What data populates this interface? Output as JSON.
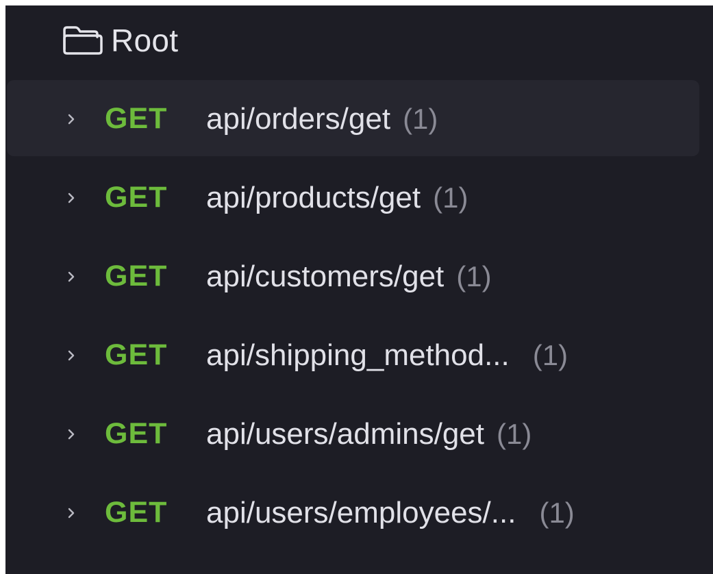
{
  "root": {
    "label": "Root",
    "icon": "folder-icon"
  },
  "colors": {
    "panel_bg": "#1d1d25",
    "selected_row_bg": "#26262f",
    "method_get": "#6dbb3c",
    "path_text": "#e1e1e8",
    "count_text": "#8a8a95"
  },
  "endpoints": [
    {
      "method": "GET",
      "path": "api/orders/get",
      "count": "(1)",
      "selected": true
    },
    {
      "method": "GET",
      "path": "api/products/get",
      "count": "(1)"
    },
    {
      "method": "GET",
      "path": "api/customers/get",
      "count": "(1)"
    },
    {
      "method": "GET",
      "path": "api/shipping_method...",
      "count": "(1)"
    },
    {
      "method": "GET",
      "path": "api/users/admins/get",
      "count": "(1)"
    },
    {
      "method": "GET",
      "path": "api/users/employees/...",
      "count": "(1)"
    }
  ]
}
